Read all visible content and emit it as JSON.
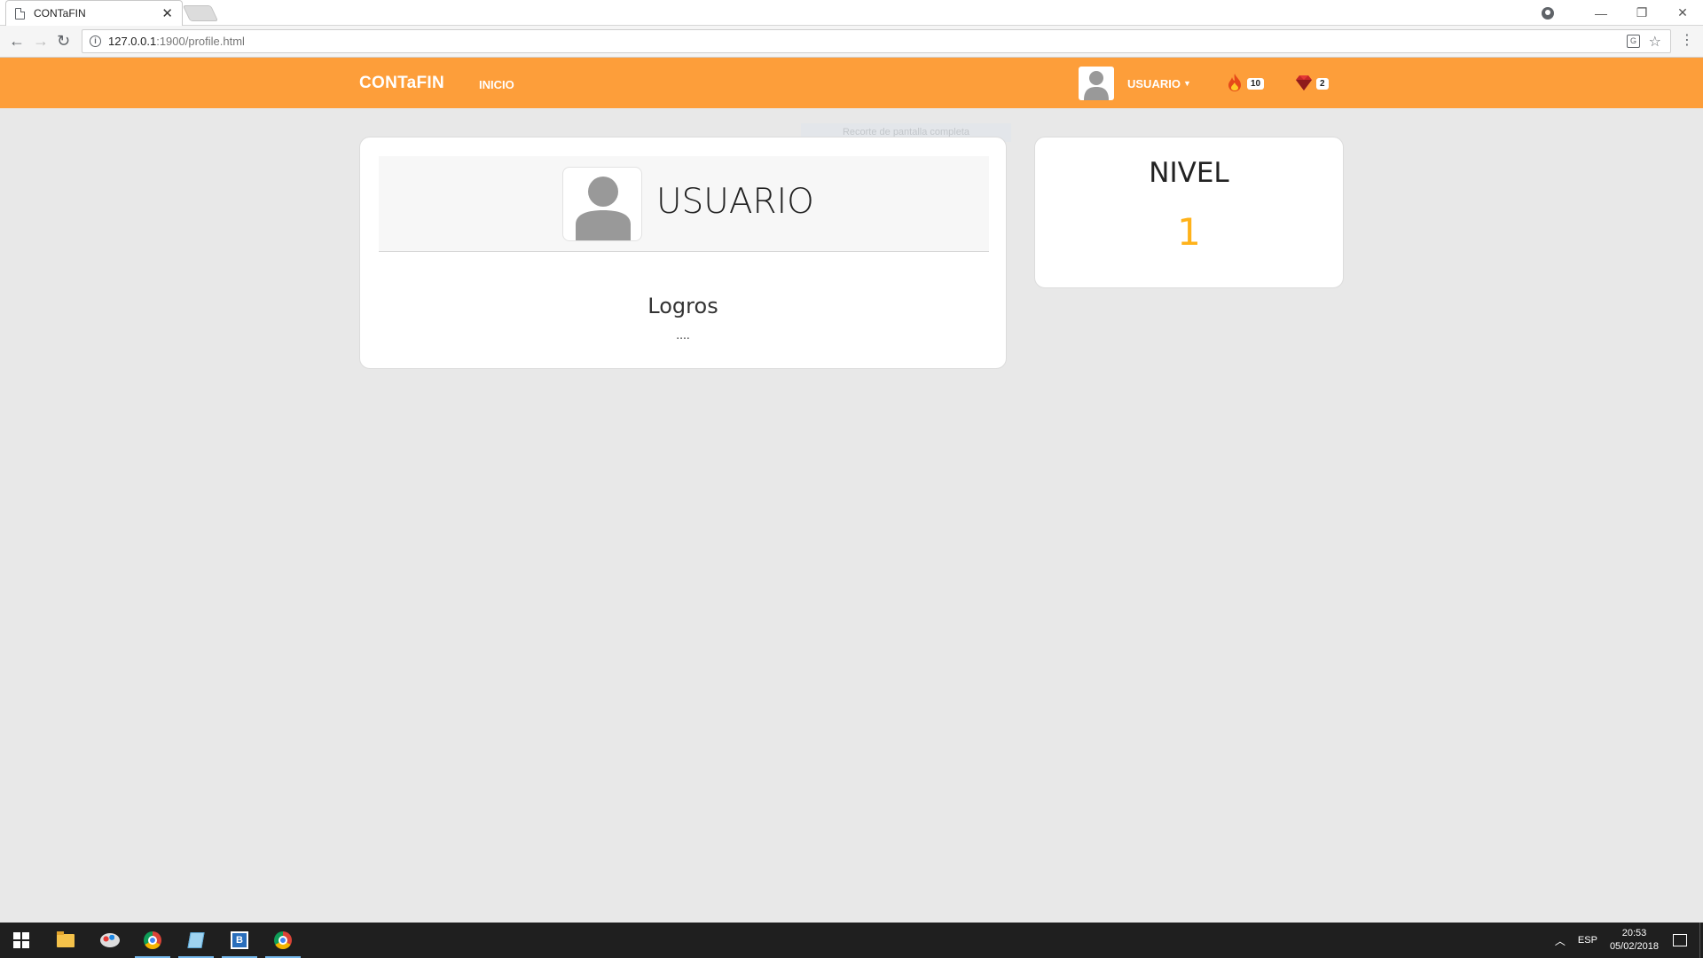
{
  "browser": {
    "tab_title": "CONTaFIN",
    "tab_close": "✕",
    "url_host": "127.0.0.1",
    "url_path": ":1900/profile.html",
    "win_minimize": "—",
    "win_restore": "❐",
    "win_close": "✕"
  },
  "navbar": {
    "brand": "CONTaFIN",
    "home_link": "INICIO",
    "user_label": "USUARIO",
    "streak_count": "10",
    "gem_count": "2",
    "accent_color": "#fd9e3a"
  },
  "snip_hint": "Recorte de pantalla completa",
  "profile": {
    "name": "USUARIO",
    "achievements_title": "Logros",
    "achievements_body": "...."
  },
  "level": {
    "label": "NIVEL",
    "value": "1",
    "value_color": "#ffb21a"
  },
  "taskbar": {
    "language": "ESP",
    "time": "20:53",
    "date": "05/02/2018"
  }
}
